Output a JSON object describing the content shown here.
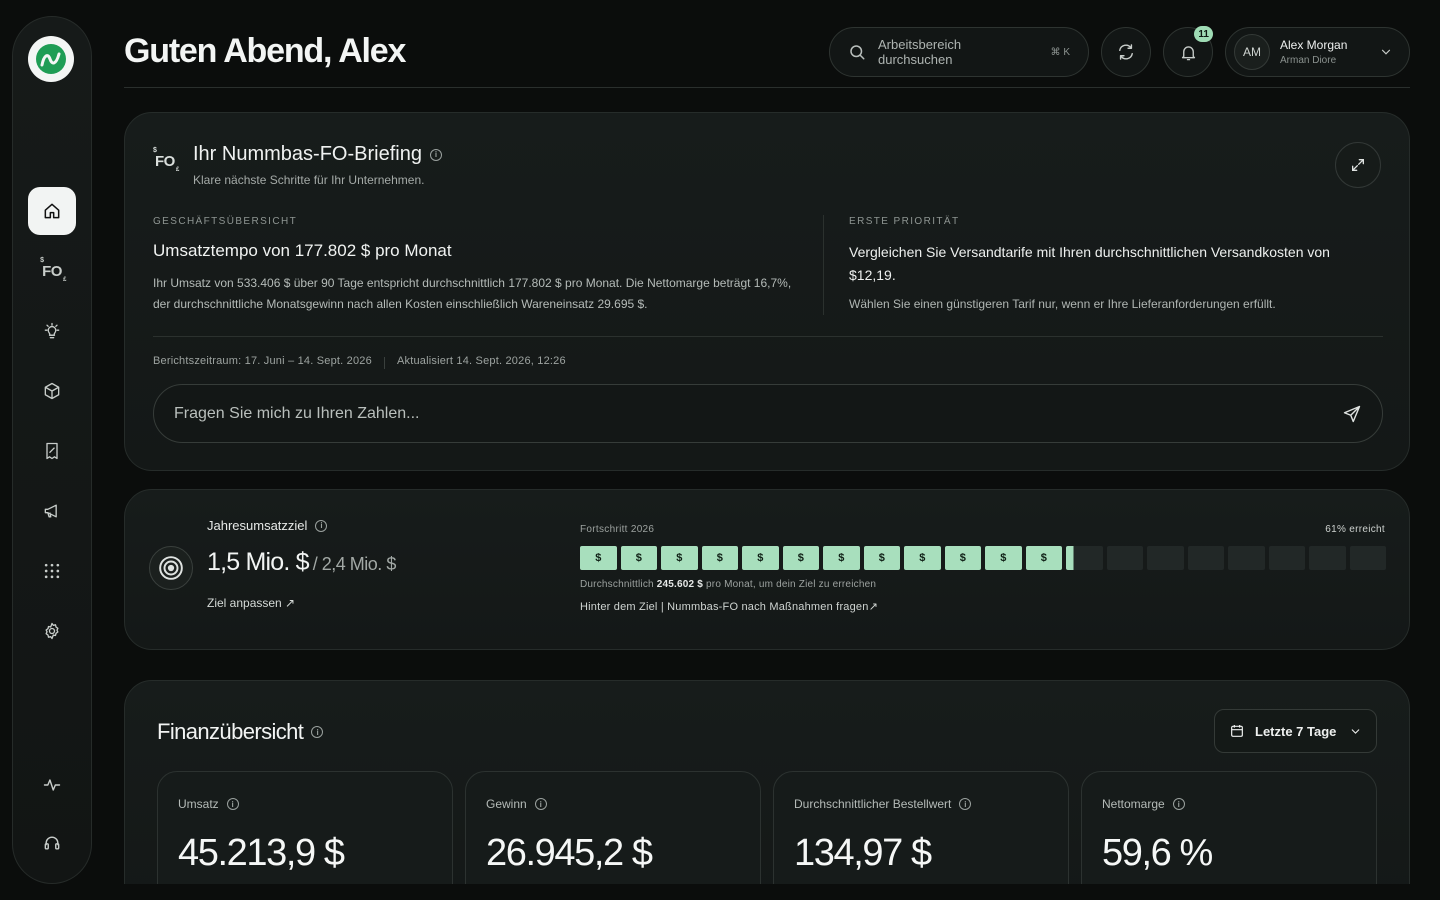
{
  "header": {
    "greeting": "Guten Abend, Alex",
    "search_placeholder": "Arbeitsbereich durchsuchen",
    "search_shortcut": "⌘ K",
    "notification_count": "11",
    "user_initials": "AM",
    "user_name": "Alex Morgan",
    "user_company": "Arman Diore"
  },
  "sidebar": {
    "items": [
      {
        "name": "home",
        "active": true
      },
      {
        "name": "fo-assistant"
      },
      {
        "name": "insights"
      },
      {
        "name": "products"
      },
      {
        "name": "reports"
      },
      {
        "name": "marketing"
      },
      {
        "name": "apps"
      },
      {
        "name": "settings"
      },
      {
        "name": "activity"
      },
      {
        "name": "support"
      }
    ]
  },
  "briefing": {
    "title": "Ihr Nummbas-FO-Briefing",
    "subtitle": "Klare nächste Schritte für Ihr Unternehmen.",
    "left_label": "GESCHÄFTSÜBERSICHT",
    "left_heading": "Umsatztempo von 177.802 $ pro Monat",
    "left_text": "Ihr Umsatz von 533.406 $ über 90 Tage entspricht durchschnittlich 177.802 $ pro Monat. Die Nettomarge beträgt 16,7%, der durchschnittliche Monatsgewinn nach allen Kosten einschließlich Wareneinsatz 29.695 $.",
    "right_label": "ERSTE PRIORITÄT",
    "right_heading": "Vergleichen Sie Versandtarife mit Ihren durchschnittlichen Versandkosten von $12,19.",
    "right_text": "Wählen Sie einen günstigeren Tarif nur, wenn er Ihre Lieferanforderungen erfüllt.",
    "period": "Berichtszeitraum: 17. Juni – 14. Sept. 2026",
    "updated": "Aktualisiert 14. Sept. 2026, 12:26",
    "ask_placeholder": "Fragen Sie mich zu Ihren Zahlen..."
  },
  "goal": {
    "title": "Jahresumsatzziel",
    "value": "1,5 Mio. $",
    "target": "/ 2,4 Mio. $",
    "adjust_link": "Ziel anpassen ↗",
    "progress_label": "Fortschritt 2026",
    "reached": "61% erreicht",
    "progress_fraction": 0.61,
    "segment_count": 20,
    "segment_symbol": "$",
    "note_prefix": "Durchschnittlich ",
    "note_value": "245.602 $",
    "note_suffix": " pro Monat, um dein Ziel zu erreichen",
    "ask_link": "Hinter dem Ziel | Nummbas-FO nach Maßnahmen fragen↗",
    "fill_color": "#a8dfbd"
  },
  "finance": {
    "title": "Finanzübersicht",
    "range": "Letzte 7 Tage",
    "kpis": [
      {
        "label": "Umsatz",
        "value": "45.213,9 $"
      },
      {
        "label": "Gewinn",
        "value": "26.945,2 $"
      },
      {
        "label": "Durchschnittlicher Bestellwert",
        "value": "134,97 $"
      },
      {
        "label": "Nettomarge",
        "value": "59,6 %"
      }
    ]
  },
  "colors": {
    "accent": "#a8dfbd",
    "logo_green": "#1f9d55",
    "background": "#0b0d0c"
  }
}
